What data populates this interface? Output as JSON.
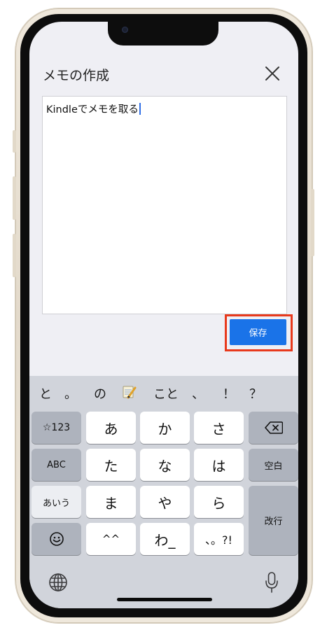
{
  "dialog": {
    "title": "メモの作成",
    "memo_text": "Kindleでメモを取る",
    "save_label": "保存"
  },
  "colors": {
    "save_button": "#1a73e8",
    "highlight_border": "#e8391c",
    "screen_background": "#efeff4",
    "keyboard_background": "#d1d4db"
  },
  "keyboard": {
    "suggestions": [
      "と",
      "。",
      "の",
      "📝",
      "こと",
      "、",
      "！",
      "？"
    ],
    "keys": {
      "numbers": "☆123",
      "a": "あ",
      "ka": "か",
      "sa": "さ",
      "delete_icon": "backspace-icon",
      "abc": "ABC",
      "ta": "た",
      "na": "な",
      "ha": "は",
      "space": "空白",
      "kana": "あいう",
      "ma": "ま",
      "ya": "や",
      "ra": "ら",
      "enter": "改行",
      "emoji_icon": "smiley-icon",
      "dakuten": "^^",
      "wa": "わ_",
      "punct": "、。?!",
      "globe_icon": "globe-icon",
      "mic_icon": "microphone-icon"
    }
  }
}
